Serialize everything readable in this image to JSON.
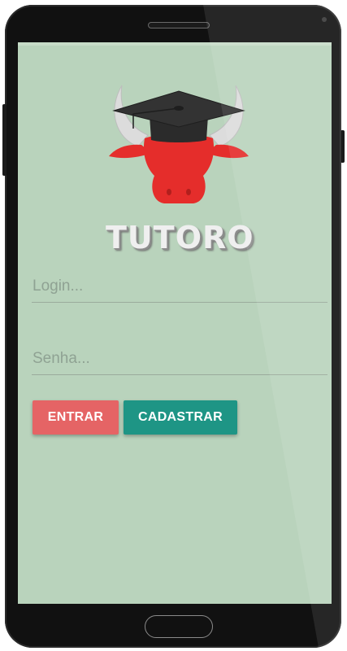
{
  "logo": {
    "text": "TUTORO",
    "icon": "bull-graduation-cap-logo",
    "colors": {
      "bull": "#e52d2b",
      "horns": "#dcdcdc",
      "cap": "#2b2b2b"
    }
  },
  "form": {
    "login_placeholder": "Login...",
    "password_placeholder": "Senha..."
  },
  "buttons": {
    "entrar_label": "ENTRAR",
    "cadastrar_label": "CADASTRAR"
  },
  "colors": {
    "screen_background": "#b9d3bc",
    "entrar_button": "#e56465",
    "cadastrar_button": "#1e9585"
  }
}
